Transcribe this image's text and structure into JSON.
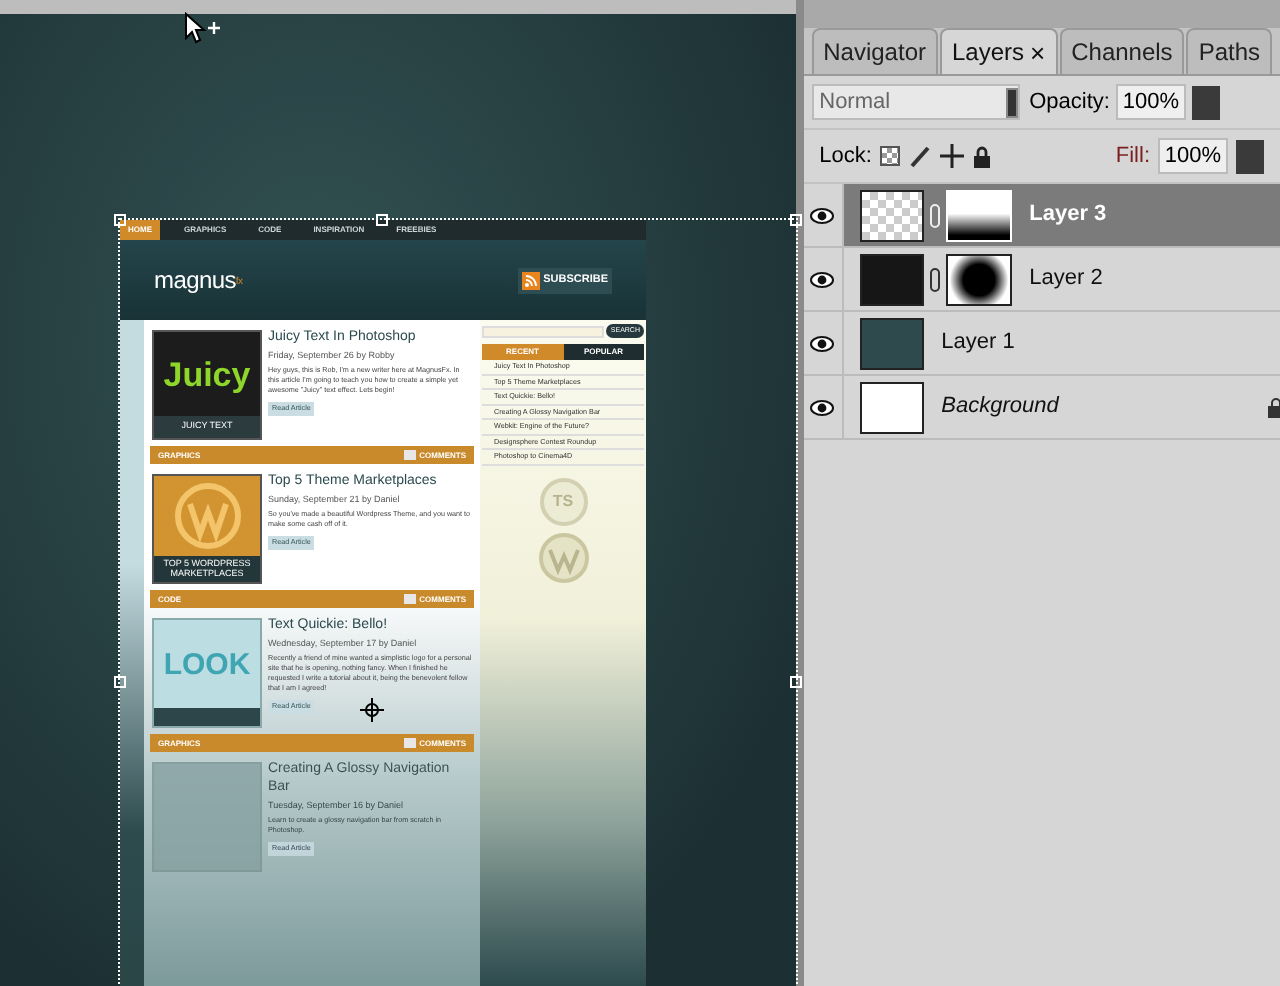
{
  "canvas": {
    "document": {
      "nav": [
        {
          "label": "HOME",
          "selected": true
        },
        {
          "label": "GRAPHICS",
          "selected": false
        },
        {
          "label": "CODE",
          "selected": false
        },
        {
          "label": "INSPIRATION",
          "selected": false
        },
        {
          "label": "FREEBIES",
          "selected": false
        }
      ],
      "logo": "magnus",
      "logo_mark": "fx",
      "subscribe": "SUBSCRIBE",
      "posts": [
        {
          "kind": "juicy",
          "thumb_text": "Juicy",
          "thumb_caption": "JUICY TEXT",
          "title": "Juicy Text In Photoshop",
          "meta": "Friday, September 26 by Robby",
          "excerpt": "Hey guys, this is Rob, I'm a new writer here at MagnusFx. In this article I'm going to teach you how to create a simple yet awesome \"Juicy\" text effect. Lets begin!",
          "button": "Read Article",
          "category": "GRAPHICS",
          "comments": "COMMENTS",
          "faded": false
        },
        {
          "kind": "wordpress",
          "thumb_caption": "TOP 5 WORDPRESS MARKETPLACES",
          "title": "Top 5 Theme Marketplaces",
          "meta": "Sunday, September 21 by Daniel",
          "excerpt": "So you've made a beautiful Wordpress Theme, and you want to make some cash off of it.",
          "button": "Read Article",
          "category": "CODE",
          "comments": "COMMENTS",
          "faded": false
        },
        {
          "kind": "look",
          "thumb_text": "LOOK",
          "title": "Text Quickie: Bello!",
          "meta": "Wednesday, September 17 by Daniel",
          "excerpt": "Recently a friend of mine wanted a simplistic logo for a personal site that he is opening, nothing fancy. When I finished he requested I write a tutorial about it, being the benevolent fellow that I am I agreed!",
          "button": "Read Article",
          "category": "GRAPHICS",
          "comments": "COMMENTS",
          "faded": false
        },
        {
          "kind": "blank",
          "title": "Creating A Glossy Navigation Bar",
          "meta": "Tuesday, September 16 by Daniel",
          "excerpt": "Learn to create a glossy navigation bar from scratch in Photoshop.",
          "button": "Read Article",
          "faded": true
        }
      ],
      "sidebar": {
        "search_button": "SEARCH",
        "tabs": [
          {
            "label": "RECENT",
            "selected": true
          },
          {
            "label": "POPULAR",
            "selected": false
          }
        ],
        "recent": [
          "Juicy Text In Photoshop",
          "Top 5 Theme Marketplaces",
          "Text Quickie: Bello!",
          "Creating A Glossy Navigation Bar",
          "Webkit: Engine of the Future?",
          "Designsphere Contest Roundup",
          "Photoshop to Cinema4D"
        ],
        "badge": "TS"
      }
    }
  },
  "panel": {
    "tabs": [
      {
        "label": "Navigator",
        "selected": false
      },
      {
        "label": "Layers",
        "selected": true,
        "close": "×"
      },
      {
        "label": "Channels",
        "selected": false
      },
      {
        "label": "Paths",
        "selected": false
      }
    ],
    "blend_mode": "Normal",
    "opacity_label": "Opacity:",
    "opacity": "100%",
    "lock_label": "Lock:",
    "fill_label": "Fill:",
    "fill": "100%",
    "layers": [
      {
        "name": "Layer 3",
        "selected": true,
        "visible": true,
        "kind": "transparent",
        "mask": {
          "kind": "gradient"
        },
        "locked": false,
        "italic": false
      },
      {
        "name": "Layer 2",
        "selected": false,
        "visible": true,
        "kind": "black",
        "mask": {
          "kind": "blur"
        },
        "locked": false,
        "italic": false
      },
      {
        "name": "Layer 1",
        "selected": false,
        "visible": true,
        "kind": "teal",
        "locked": false,
        "italic": false
      },
      {
        "name": "Background",
        "selected": false,
        "visible": true,
        "kind": "white",
        "locked": true,
        "italic": true
      }
    ]
  }
}
